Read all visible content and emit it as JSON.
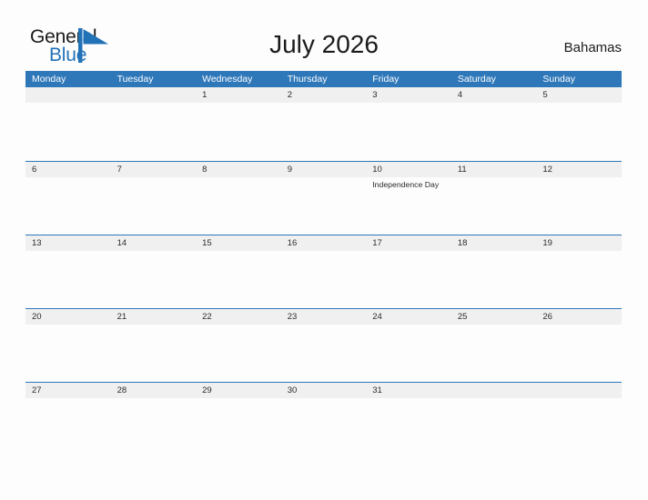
{
  "brand": {
    "name_part1": "General",
    "name_part2": "Blue",
    "flag_icon": "blue-flag-triangle-icon",
    "color_black": "#1a1a1a",
    "color_blue": "#2272b8"
  },
  "header": {
    "title": "July 2026",
    "country": "Bahamas"
  },
  "theme": {
    "header_blue": "#2e77b9",
    "row_band_gray": "#f0f0f0",
    "page_background": "#fdfdfd",
    "text_color": "#2b2b2b"
  },
  "calendar": {
    "month": "July",
    "year": "2026",
    "day_headers": [
      "Monday",
      "Tuesday",
      "Wednesday",
      "Thursday",
      "Friday",
      "Saturday",
      "Sunday"
    ],
    "weeks": [
      [
        {
          "date": "",
          "events": []
        },
        {
          "date": "",
          "events": []
        },
        {
          "date": "1",
          "events": []
        },
        {
          "date": "2",
          "events": []
        },
        {
          "date": "3",
          "events": []
        },
        {
          "date": "4",
          "events": []
        },
        {
          "date": "5",
          "events": []
        }
      ],
      [
        {
          "date": "6",
          "events": []
        },
        {
          "date": "7",
          "events": []
        },
        {
          "date": "8",
          "events": []
        },
        {
          "date": "9",
          "events": []
        },
        {
          "date": "10",
          "events": [
            "Independence Day"
          ]
        },
        {
          "date": "11",
          "events": []
        },
        {
          "date": "12",
          "events": []
        }
      ],
      [
        {
          "date": "13",
          "events": []
        },
        {
          "date": "14",
          "events": []
        },
        {
          "date": "15",
          "events": []
        },
        {
          "date": "16",
          "events": []
        },
        {
          "date": "17",
          "events": []
        },
        {
          "date": "18",
          "events": []
        },
        {
          "date": "19",
          "events": []
        }
      ],
      [
        {
          "date": "20",
          "events": []
        },
        {
          "date": "21",
          "events": []
        },
        {
          "date": "22",
          "events": []
        },
        {
          "date": "23",
          "events": []
        },
        {
          "date": "24",
          "events": []
        },
        {
          "date": "25",
          "events": []
        },
        {
          "date": "26",
          "events": []
        }
      ],
      [
        {
          "date": "27",
          "events": []
        },
        {
          "date": "28",
          "events": []
        },
        {
          "date": "29",
          "events": []
        },
        {
          "date": "30",
          "events": []
        },
        {
          "date": "31",
          "events": []
        },
        {
          "date": "",
          "events": []
        },
        {
          "date": "",
          "events": []
        }
      ]
    ]
  }
}
